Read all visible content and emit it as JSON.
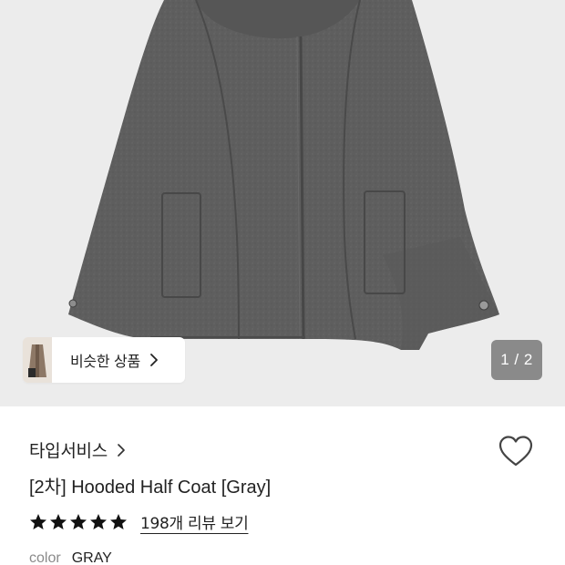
{
  "product_image": {
    "alt": "product-photo",
    "similar_products_label": "비슷한 상품",
    "page_indicator": "1 / 2",
    "current_page": 1,
    "total_pages": 2
  },
  "product": {
    "brand": "타입서비스",
    "title": "[2차] Hooded Half Coat [Gray]",
    "rating": 5,
    "review_link": "198개 리뷰 보기",
    "option_key": "color",
    "option_value": "GRAY"
  },
  "icons": {
    "chevron": "chevron-right-icon",
    "wish": "heart-outline-icon",
    "star": "star-filled-icon"
  },
  "colors": {
    "image_background": "#ececec",
    "coat": "#5c5c5c",
    "indicator_background": "#8a8a8a",
    "text": "#222222",
    "muted": "#8a8a8a"
  }
}
